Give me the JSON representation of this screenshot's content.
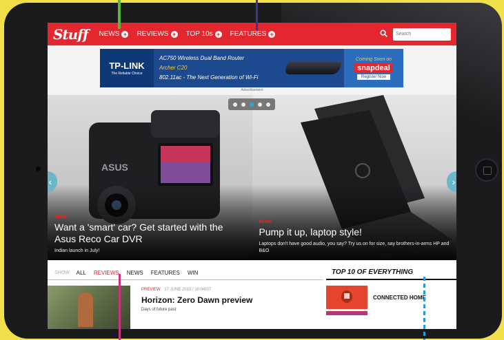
{
  "navbar": {
    "logo": "Stuff",
    "items": [
      {
        "label": "NEWS"
      },
      {
        "label": "REVIEWS"
      },
      {
        "label": "TOP 10s"
      },
      {
        "label": "FEATURES"
      }
    ],
    "search_placeholder": "Search"
  },
  "ad": {
    "brand": "TP-LINK",
    "brand_tag": "The Reliable Choice",
    "headline": "AC750 Wireless Dual Band Router",
    "product": "Archer C20",
    "tagline": "802.11ac - The Next Generation of Wi-Fi",
    "partner_soon": "Coming Soon on",
    "partner": "snapdeal",
    "cta": "Register Now",
    "label": "Advertisement"
  },
  "carousel": {
    "active_index": 2,
    "count": 5
  },
  "slides": [
    {
      "tag": "NEWS",
      "title": "Want a 'smart' car? Get started with the Asus Reco Car DVR",
      "desc": "Indian launch in July!",
      "camera_brand": "ASUS"
    },
    {
      "tag": "NEWS",
      "title": "Pump it up, laptop style!",
      "desc": "Laptops don't have good audio, you say? Try us on for size, say brothers-in-arms HP and B&O"
    }
  ],
  "subnav": {
    "show_label": "SHOW:",
    "items": [
      "ALL",
      "REVIEWS",
      "NEWS",
      "FEATURES",
      "WIN"
    ],
    "active": "REVIEWS"
  },
  "article": {
    "tag": "PREVIEW",
    "date": "17 JUNE 2015 / 10:04IST",
    "title": "Horizon: Zero Dawn preview",
    "desc": "Days of future past"
  },
  "sidebar": {
    "title": "TOP 10 OF EVERYTHING",
    "items": [
      {
        "label": "CONNECTED HOME"
      }
    ]
  },
  "colors": {
    "brand_red": "#e4262f",
    "background_yellow": "#f2e04a",
    "carousel_active": "#2aa7d6",
    "callout_green": "#56b73c",
    "callout_blue": "#32399a",
    "callout_pink": "#c8357e",
    "callout_cyan": "#2a9bd8"
  }
}
